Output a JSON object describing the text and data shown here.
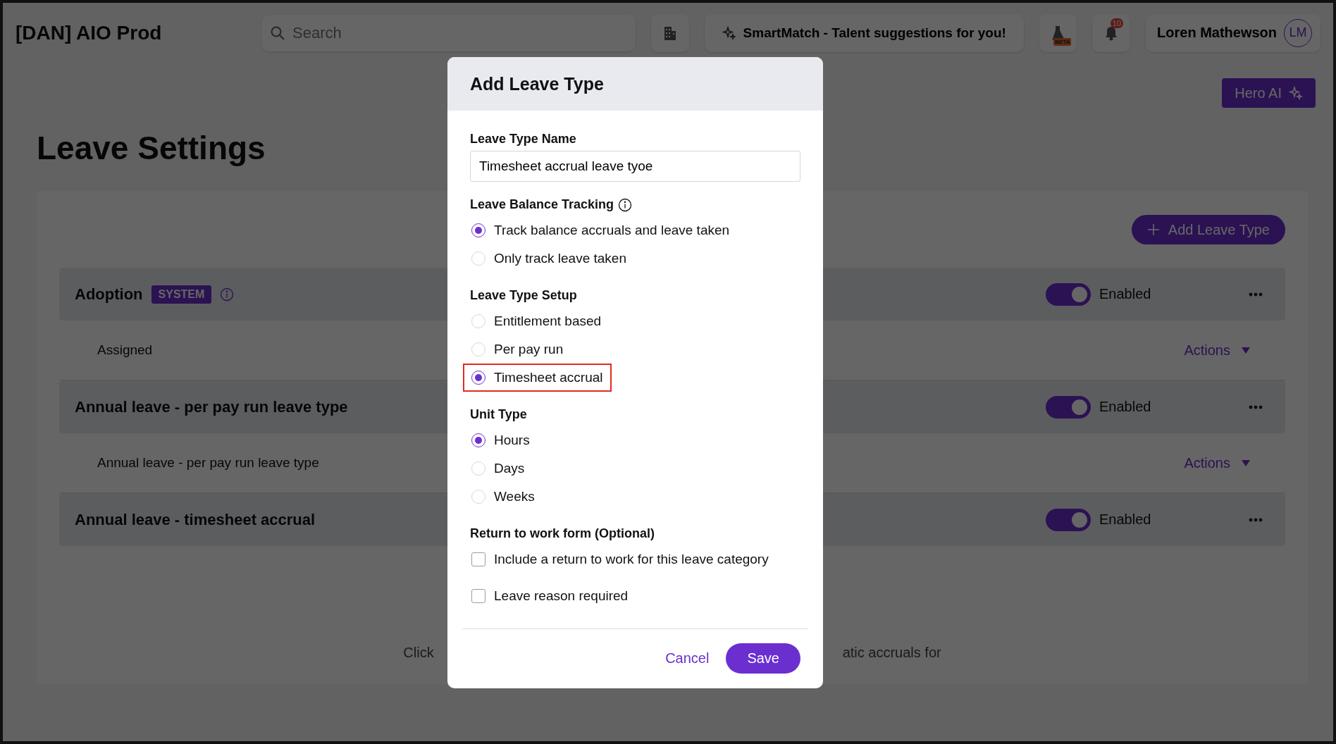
{
  "topbar": {
    "title": "[DAN] AIO Prod",
    "search": {
      "placeholder": "Search"
    },
    "smartmatch": "SmartMatch - Talent suggestions for you!",
    "beta_badge": "BETA",
    "notifications_count": "10",
    "user": {
      "name": "Loren Mathewson",
      "initials": "LM"
    }
  },
  "hero_ai": "Hero AI",
  "page_title": "Leave Settings",
  "add_button": "Add Leave Type",
  "leave_types": [
    {
      "name": "Adoption",
      "badge": "SYSTEM",
      "info": true,
      "enabled": true,
      "status": "Enabled",
      "detail": "Assigned",
      "actions": "Actions"
    },
    {
      "name": "Annual leave - per pay run leave type",
      "info": false,
      "enabled": true,
      "status": "Enabled",
      "detail": "Annual leave - per pay run leave type",
      "actions": "Actions"
    },
    {
      "name": "Annual leave - timesheet accrual",
      "info": false,
      "enabled": true,
      "status": "Enabled"
    }
  ],
  "hint": [
    "Click",
    "atic accruals for"
  ],
  "dialog": {
    "title": "Add Leave Type",
    "name_field": {
      "label": "Leave Type Name",
      "value": "Timesheet accrual leave tyoe"
    },
    "sections": [
      {
        "kind": "radio",
        "label": "Leave Balance Tracking",
        "info": true,
        "options": [
          {
            "label": "Track balance accruals and leave taken",
            "selected": true,
            "highlighted": false
          },
          {
            "label": "Only track leave taken",
            "selected": false,
            "highlighted": false
          }
        ]
      },
      {
        "kind": "radio",
        "label": "Leave Type Setup",
        "info": false,
        "options": [
          {
            "label": "Entitlement based",
            "selected": false,
            "highlighted": false
          },
          {
            "label": "Per pay run",
            "selected": false,
            "highlighted": false
          },
          {
            "label": "Timesheet accrual",
            "selected": true,
            "highlighted": true
          }
        ]
      },
      {
        "kind": "radio",
        "label": "Unit Type",
        "info": false,
        "options": [
          {
            "label": "Hours",
            "selected": true,
            "highlighted": false
          },
          {
            "label": "Days",
            "selected": false,
            "highlighted": false
          },
          {
            "label": "Weeks",
            "selected": false,
            "highlighted": false
          }
        ]
      },
      {
        "kind": "checkbox",
        "label": "Return to work form (Optional)",
        "info": false,
        "options": [
          {
            "label": "Include a return to work for this leave category",
            "checked": false
          },
          {
            "label": "Leave reason required",
            "checked": false
          }
        ]
      }
    ],
    "cancel": "Cancel",
    "save": "Save"
  }
}
